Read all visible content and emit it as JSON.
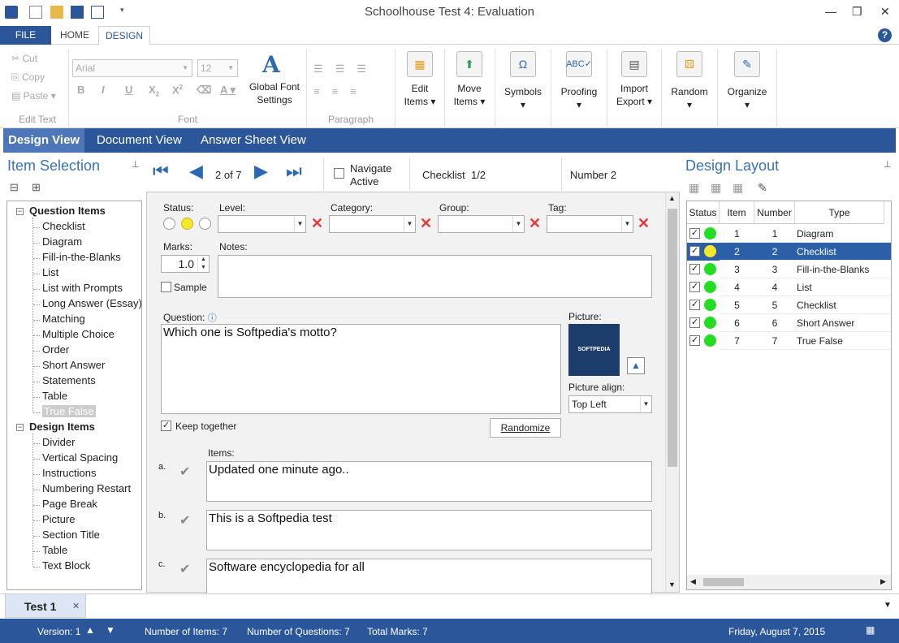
{
  "title": "Schoolhouse Test 4: Evaluation",
  "ribbon_tabs": {
    "file": "FILE",
    "home": "HOME",
    "design": "DESIGN"
  },
  "clipboard": {
    "cut": "Cut",
    "copy": "Copy",
    "paste": "Paste",
    "group": "Edit Text"
  },
  "font": {
    "name": "Arial",
    "size": "12",
    "group": "Font",
    "global_label1": "Global Font",
    "global_label2": "Settings"
  },
  "paragraph": {
    "group": "Paragraph"
  },
  "big_buttons": {
    "edit1": "Edit",
    "edit2": "Items",
    "move1": "Move",
    "move2": "Items",
    "symbols": "Symbols",
    "proofing": "Proofing",
    "import1": "Import",
    "import2": "Export",
    "random": "Random",
    "organize": "Organize"
  },
  "view_tabs": {
    "design": "Design View",
    "document": "Document View",
    "answer": "Answer Sheet View"
  },
  "left_panel": {
    "title": "Item Selection",
    "question_header": "Question Items",
    "question_items": [
      "Checklist",
      "Diagram",
      "Fill-in-the-Blanks",
      "List",
      "List with Prompts",
      "Long Answer (Essay)",
      "Matching",
      "Multiple Choice",
      "Order",
      "Short Answer",
      "Statements",
      "Table",
      "True False"
    ],
    "design_header": "Design Items",
    "design_items": [
      "Divider",
      "Vertical Spacing",
      "Instructions",
      "Numbering Restart",
      "Page Break",
      "Picture",
      "Section Title",
      "Table",
      "Text Block"
    ]
  },
  "nav": {
    "position": "2 of 7",
    "navigate1": "Navigate",
    "navigate2": "Active",
    "item_type": "Checklist  1/2",
    "number": "Number 2"
  },
  "editor": {
    "status_label": "Status:",
    "level_label": "Level:",
    "category_label": "Category:",
    "group_label": "Group:",
    "tag_label": "Tag:",
    "marks_label": "Marks:",
    "marks_value": "1.0",
    "notes_label": "Notes:",
    "sample_label": "Sample",
    "question_label": "Question:",
    "question_text": "Which one is Softpedia's motto?",
    "picture_label": "Picture:",
    "picture_text": "SOFTPEDIA",
    "picture_align_label": "Picture align:",
    "picture_align_value": "Top Left",
    "keep_together_label": "Keep together",
    "randomize_label": "Randomize",
    "items_label": "Items:",
    "items": [
      {
        "letter": "a.",
        "text": "Updated one minute ago.."
      },
      {
        "letter": "b.",
        "text": "This is a Softpedia test"
      },
      {
        "letter": "c.",
        "text": "Software encyclopedia for all"
      }
    ]
  },
  "right_panel": {
    "title": "Design Layout",
    "columns": [
      "Status",
      "Item",
      "Number",
      "Type"
    ],
    "rows": [
      {
        "item": "1",
        "number": "1",
        "type": "Diagram",
        "color": "#22dd22"
      },
      {
        "item": "2",
        "number": "2",
        "type": "Checklist",
        "color": "#f5e72a"
      },
      {
        "item": "3",
        "number": "3",
        "type": "Fill-in-the-Blanks",
        "color": "#22dd22"
      },
      {
        "item": "4",
        "number": "4",
        "type": "List",
        "color": "#22dd22"
      },
      {
        "item": "5",
        "number": "5",
        "type": "Checklist",
        "color": "#22dd22"
      },
      {
        "item": "6",
        "number": "6",
        "type": "Short Answer",
        "color": "#22dd22"
      },
      {
        "item": "7",
        "number": "7",
        "type": "True False",
        "color": "#22dd22"
      }
    ]
  },
  "doc_tab": {
    "label": "Test 1"
  },
  "status": {
    "version": "Version: 1",
    "items": "Number of Items: 7",
    "questions": "Number of Questions: 7",
    "marks": "Total Marks: 7",
    "date": "Friday, August 7, 2015"
  }
}
